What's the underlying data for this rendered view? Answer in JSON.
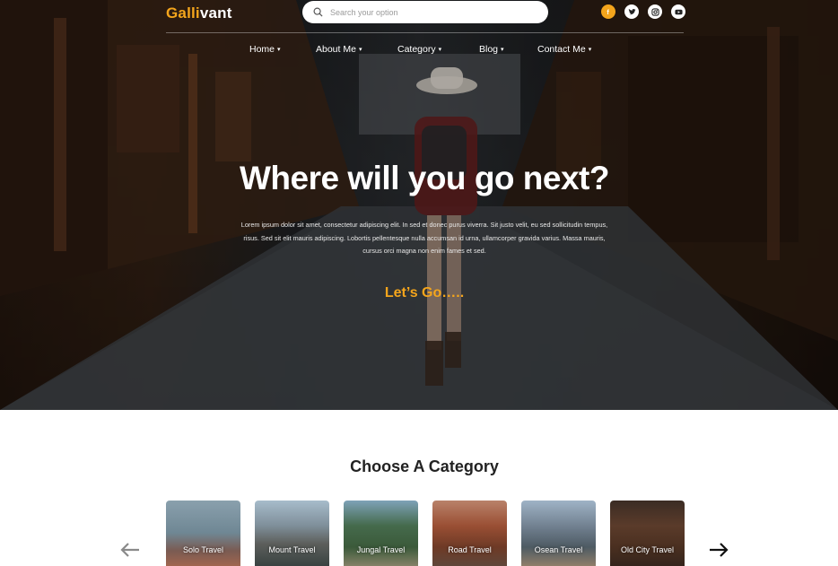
{
  "brand": {
    "part1": "Galli",
    "part2": "vant"
  },
  "search": {
    "placeholder": "Search your option"
  },
  "social": [
    "facebook-icon",
    "twitter-icon",
    "instagram-icon",
    "youtube-icon"
  ],
  "nav": [
    {
      "label": "Home"
    },
    {
      "label": "About Me"
    },
    {
      "label": "Category"
    },
    {
      "label": "Blog"
    },
    {
      "label": "Contact Me"
    }
  ],
  "hero": {
    "title": "Where will you go next?",
    "body": "Lorem ipsum dolor sit amet, consectetur adipiscing elit. In sed et donec purus viverra. Sit justo velit, eu sed sollicitudin tempus, risus. Sed sit elit mauris adipiscing. Lobortis pellentesque nulla accumsan id urna, ullamcorper gravida varius. Massa mauris, cursus orci magna non enim fames et sed.",
    "cta": "Let’s Go….."
  },
  "categories": {
    "title": "Choose A Category",
    "items": [
      {
        "label": "Solo Travel"
      },
      {
        "label": "Mount Travel"
      },
      {
        "label": "Jungal Travel"
      },
      {
        "label": "Road Travel"
      },
      {
        "label": "Osean Travel"
      },
      {
        "label": "Old City Travel"
      }
    ]
  },
  "colors": {
    "accent": "#f4a51c",
    "text_dark": "#222222",
    "white": "#ffffff"
  }
}
